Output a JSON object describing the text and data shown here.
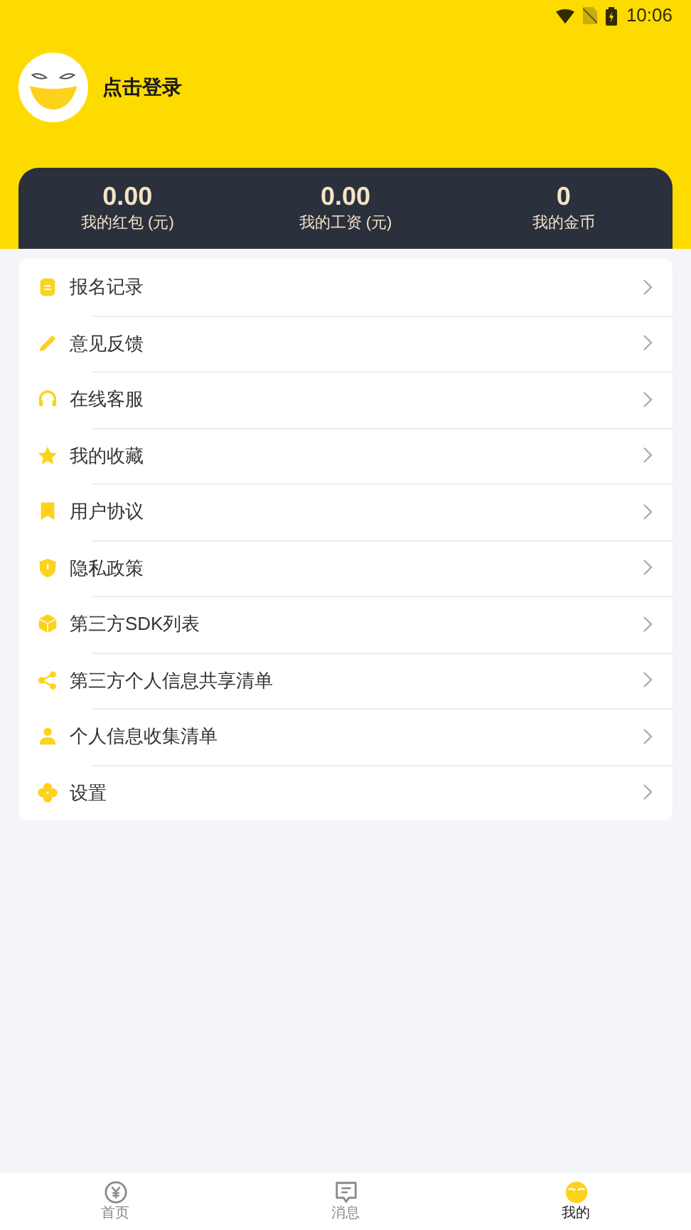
{
  "status_bar": {
    "time": "10:06"
  },
  "profile": {
    "login": "点击登录"
  },
  "stats": [
    {
      "value": "0.00",
      "label": "我的红包 (元)"
    },
    {
      "value": "0.00",
      "label": "我的工资 (元)"
    },
    {
      "value": "0",
      "label": "我的金币"
    }
  ],
  "menu": [
    {
      "label": "报名记录"
    },
    {
      "label": "意见反馈"
    },
    {
      "label": "在线客服"
    },
    {
      "label": "我的收藏"
    },
    {
      "label": "用户协议"
    },
    {
      "label": "隐私政策"
    },
    {
      "label": "第三方SDK列表"
    },
    {
      "label": "第三方个人信息共享清单"
    },
    {
      "label": "个人信息收集清单"
    },
    {
      "label": "设置"
    }
  ],
  "tabs": [
    {
      "label": "首页",
      "selected": false
    },
    {
      "label": "消息",
      "selected": false
    },
    {
      "label": "我的",
      "selected": true
    }
  ]
}
